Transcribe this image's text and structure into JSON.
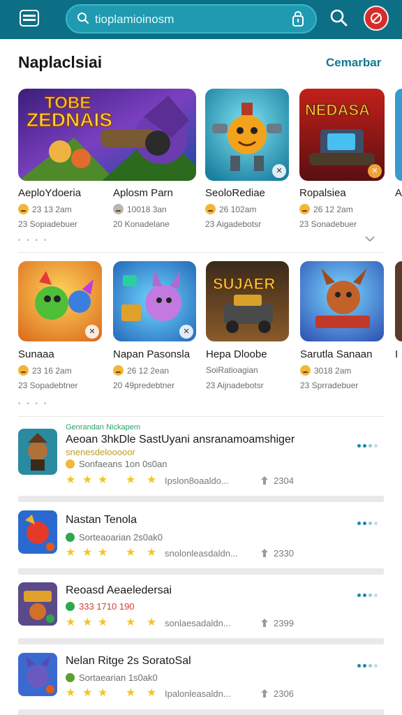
{
  "topbar": {
    "menu_icon": "menu-icon",
    "search_text": "tioplamioinosm",
    "lock_icon": "lock-icon",
    "search_icon": "search-icon",
    "profile_icon": "profile-icon",
    "bar_color": "#0c6f86",
    "profile_color": "#d92b2b"
  },
  "section": {
    "title": "Naplaclsiai",
    "link": "Cemarbar",
    "accent": "#127891"
  },
  "row1": [
    {
      "title": "AeploYdoeria",
      "meta1": "23 13 2am",
      "meta2": "23 Sopiadebuer",
      "thumb_text_1": "TOBE",
      "thumb_text_2": "ZEDNAIS"
    },
    {
      "title": "Aplosm Parn",
      "meta1": "10018 3an",
      "meta2": "20 Konadelane"
    },
    {
      "title": "SeoloRediae",
      "meta1": "26 102am",
      "meta2": "23 Aigadebotsr"
    },
    {
      "title": "Ropalsiea",
      "meta1": "26 12 2am",
      "meta2": "23 Sonadebuer",
      "thumb_text_1": "NEDASA"
    },
    {
      "title": "A"
    }
  ],
  "row2": [
    {
      "title": "Sunaaa",
      "meta1": "23 16 2am",
      "meta2": "23 Sopadebtner"
    },
    {
      "title": "Napan Pasonsla",
      "meta1": "26 12 2ean",
      "meta2": "20 49predebtner"
    },
    {
      "title": "Hepa Dloobe",
      "meta1": "SoiRatioagian",
      "meta2": "23 Aijnadebotsr",
      "thumb_text_1": "SUJAER"
    },
    {
      "title": "Sarutla Sanaan",
      "meta1": "3018 2am",
      "meta2": "23 Sprradebuer"
    },
    {
      "title": "I"
    }
  ],
  "list": [
    {
      "tag": "Genrandan Nickapem",
      "title": "Aeoan 3hkDle SastUyani ansranamoamshiger",
      "sub": "snenesdelooooor",
      "sub2": "Sonfaeans 1on 0s0an",
      "desc": "Ipslon8oaaldo...",
      "count": "2304",
      "rating": 4.5
    },
    {
      "title": "Nastan Tenola",
      "sub": "Sorteaoarian 2s0ak0",
      "desc": "snolonleasdaldn...",
      "count": "2330",
      "rating": 4.5
    },
    {
      "title": "Reoasd Aeaeledersai",
      "sub": "333 1710 190",
      "desc": "sonlaesadaldn...",
      "count": "2399",
      "rating": 4.5
    },
    {
      "title": "Nelan Ritge 2s SoratoSal",
      "sub": "Sortaearian 1s0ak0",
      "desc": "Ipalonleasaldn...",
      "count": "2306",
      "rating": 4.5
    }
  ]
}
